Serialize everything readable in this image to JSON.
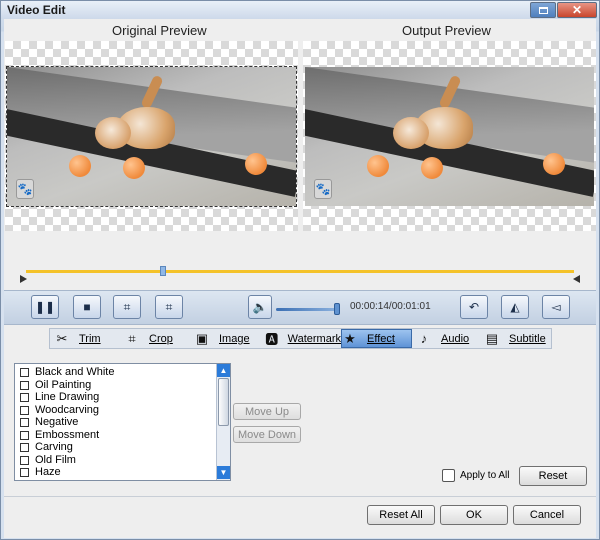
{
  "window": {
    "title": "Video Edit"
  },
  "preview": {
    "original_label": "Original Preview",
    "output_label": "Output Preview"
  },
  "playback": {
    "time": "00:00:14/00:01:01",
    "progress_fraction": 0.25,
    "volume_fraction": 0.95,
    "buttons": [
      "play-pause",
      "stop",
      "mark-in",
      "mark-out"
    ],
    "right_buttons": [
      "rotate",
      "flip-horizontal",
      "flip-vertical"
    ]
  },
  "tabs": [
    {
      "icon": "scissors",
      "label": "Trim"
    },
    {
      "icon": "crop",
      "label": "Crop"
    },
    {
      "icon": "image",
      "label": "Image"
    },
    {
      "icon": "watermark",
      "label": "Watermark"
    },
    {
      "icon": "star",
      "label": "Effect",
      "active": true
    },
    {
      "icon": "music-note",
      "label": "Audio"
    },
    {
      "icon": "subtitle",
      "label": "Subtitle"
    }
  ],
  "effects": [
    "Black and White",
    "Oil Painting",
    "Line Drawing",
    "Woodcarving",
    "Negative",
    "Embossment",
    "Carving",
    "Old Film",
    "Haze"
  ],
  "buttons": {
    "move_up": "Move Up",
    "move_down": "Move Down",
    "apply_to_all": "Apply to All",
    "reset": "Reset",
    "reset_all": "Reset All",
    "ok": "OK",
    "cancel": "Cancel"
  },
  "colors": {
    "timeline": "#f4c229",
    "accent": "#5f93d6",
    "close_button": "#c9452d"
  }
}
